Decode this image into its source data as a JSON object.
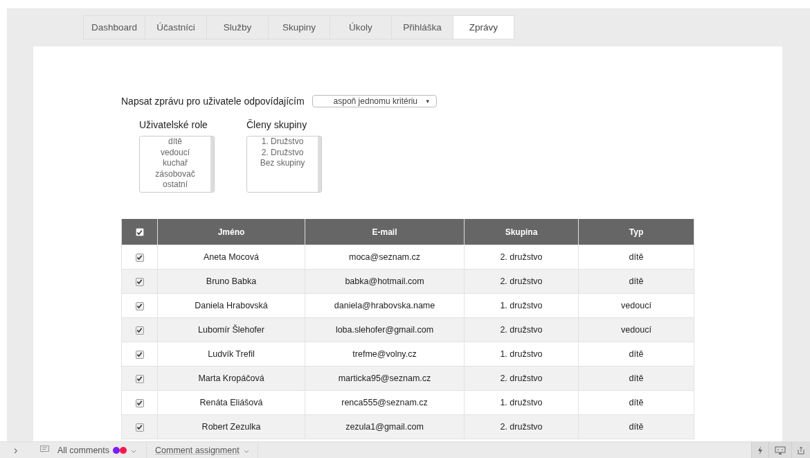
{
  "tabs": [
    {
      "label": "Dashboard",
      "selected": false
    },
    {
      "label": "Účastníci",
      "selected": false
    },
    {
      "label": "Služby",
      "selected": false
    },
    {
      "label": "Skupiny",
      "selected": false
    },
    {
      "label": "Úkoly",
      "selected": false
    },
    {
      "label": "Přihláška",
      "selected": false
    },
    {
      "label": "Zprávy",
      "selected": true
    }
  ],
  "filter": {
    "label": "Napsat zprávu pro uživatele odpovídajícím",
    "select_value": "aspoň jednomu kritériu",
    "select_arrow": "▼"
  },
  "lists": [
    {
      "label": "Uživatelské role",
      "options": [
        "dítě",
        "vedoucí",
        "kuchař",
        "zásobovač",
        "ostatní"
      ]
    },
    {
      "label": "Členy skupiny",
      "options": [
        "1. Družstvo",
        "2. Družstvo",
        "Bez skupiny"
      ]
    }
  ],
  "table": {
    "select_all_checked": true,
    "columns": [
      "Jméno",
      "E-mail",
      "Skupina",
      "Typ"
    ],
    "rows": [
      {
        "checked": true,
        "cells": [
          "Aneta Mocová",
          "moca@seznam.cz",
          "2. družstvo",
          "dítě"
        ]
      },
      {
        "checked": true,
        "cells": [
          "Bruno Babka",
          "babka@hotmail.com",
          "2. družstvo",
          "dítě"
        ]
      },
      {
        "checked": true,
        "cells": [
          "Daniela Hrabovská",
          "daniela@hrabovska.name",
          "1. družstvo",
          "vedoucí"
        ]
      },
      {
        "checked": true,
        "cells": [
          "Lubomír Šlehofer",
          "loba.slehofer@gmail.com",
          "2. družstvo",
          "vedoucí"
        ]
      },
      {
        "checked": true,
        "cells": [
          "Ludvík Trefil",
          "trefme@volny.cz",
          "1. družstvo",
          "dítě"
        ]
      },
      {
        "checked": true,
        "cells": [
          "Marta Kropáčová",
          "marticka95@seznam.cz",
          "2. družstvo",
          "dítě"
        ]
      },
      {
        "checked": true,
        "cells": [
          "Renáta Eliášová",
          "renca555@seznam.cz",
          "1. družstvo",
          "dítě"
        ]
      },
      {
        "checked": true,
        "cells": [
          "Robert Zezulka",
          "zezula1@gmail.com",
          "2. družstvo",
          "dítě"
        ]
      }
    ]
  },
  "bottom_bar": {
    "expand": "›",
    "comments_label": "All comments",
    "comment_dots": [
      {
        "color": "#7b1cff"
      },
      {
        "color": "#ff1744"
      }
    ],
    "assignment_label": "Comment assignment"
  }
}
